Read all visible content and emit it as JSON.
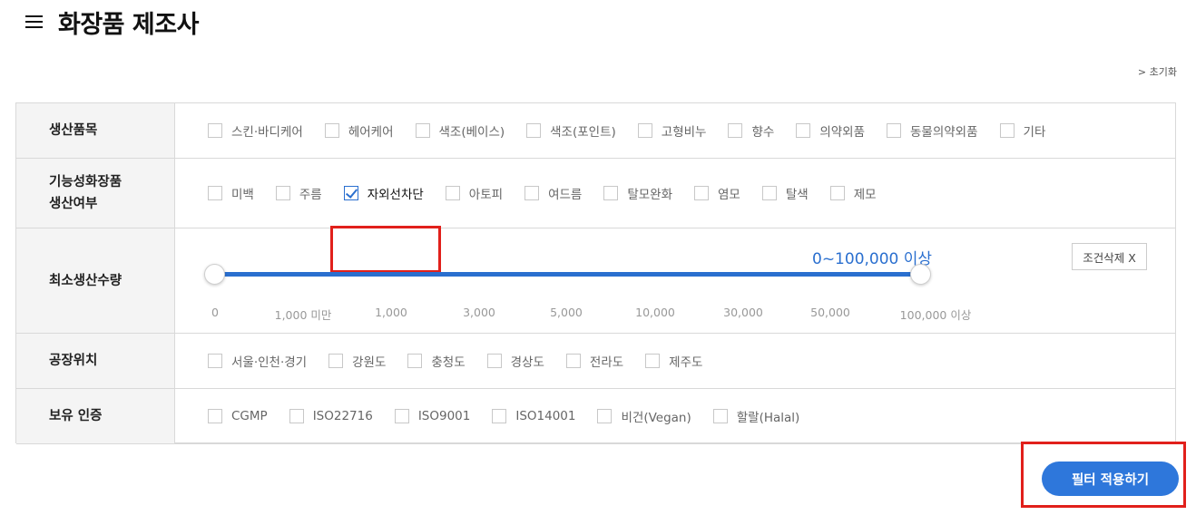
{
  "header": {
    "title": "화장품 제조사",
    "menu_icon": "hamburger-menu-icon"
  },
  "reset_link": "> 초기화",
  "filters": {
    "product_category": {
      "label": "생산품목",
      "options": [
        "스킨·바디케어",
        "헤어케어",
        "색조(베이스)",
        "색조(포인트)",
        "고형비누",
        "향수",
        "의약외품",
        "동물의약외품",
        "기타"
      ]
    },
    "functional": {
      "label_line1": "기능성화장품",
      "label_line2": "생산여부",
      "options": [
        "미백",
        "주름",
        "자외선차단",
        "아토피",
        "여드름",
        "탈모완화",
        "염모",
        "탈색",
        "제모"
      ],
      "checked": "자외선차단"
    },
    "min_quantity": {
      "label": "최소생산수량",
      "range_value": "0~100,000 이상",
      "clear_button": "조건삭제 X",
      "ticks": [
        "0",
        "1,000 미만",
        "1,000",
        "3,000",
        "5,000",
        "10,000",
        "30,000",
        "50,000",
        "100,000 이상"
      ],
      "selected_min": "0",
      "selected_max": "100,000 이상"
    },
    "location": {
      "label": "공장위치",
      "options": [
        "서울·인천·경기",
        "강원도",
        "충청도",
        "경상도",
        "전라도",
        "제주도"
      ]
    },
    "certification": {
      "label": "보유 인증",
      "options": [
        "CGMP",
        "ISO22716",
        "ISO9001",
        "ISO14001",
        "비건(Vegan)",
        "할랄(Halal)"
      ]
    }
  },
  "apply_button": "필터 적용하기",
  "colors": {
    "accent": "#2e77db",
    "highlight": "#e1201b",
    "label_bg": "#f4f4f4"
  }
}
